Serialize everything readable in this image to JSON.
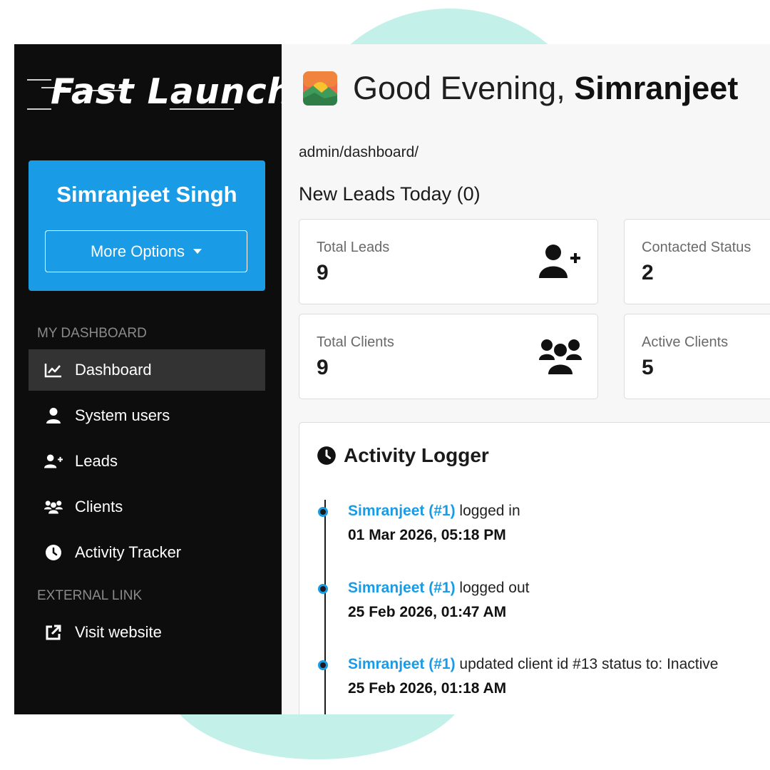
{
  "brand": {
    "logo_text": "Fast Launch"
  },
  "profile": {
    "name": "Simranjeet Singh",
    "more_options_label": "More Options"
  },
  "sidebar": {
    "sections": [
      {
        "label": "MY DASHBOARD"
      },
      {
        "label": "EXTERNAL LINK"
      }
    ],
    "items": [
      {
        "label": "Dashboard",
        "icon": "chart-line-icon",
        "active": true
      },
      {
        "label": "System users",
        "icon": "user-icon",
        "active": false
      },
      {
        "label": "Leads",
        "icon": "user-plus-icon",
        "active": false
      },
      {
        "label": "Clients",
        "icon": "users-icon",
        "active": false
      },
      {
        "label": "Activity Tracker",
        "icon": "clock-icon",
        "active": false
      },
      {
        "label": "Visit website",
        "icon": "external-link-icon",
        "active": false
      }
    ]
  },
  "header": {
    "greeting": "Good Evening, ",
    "user_first_name": "Simranjeet",
    "breadcrumb": "admin/dashboard/",
    "new_leads_heading": "New Leads Today (0)"
  },
  "stats": [
    {
      "label": "Total Leads",
      "value": "9",
      "icon": "user-plus-icon"
    },
    {
      "label": "Contacted Status",
      "value": "2",
      "icon": ""
    },
    {
      "label": "Total Clients",
      "value": "9",
      "icon": "users-icon"
    },
    {
      "label": "Active Clients",
      "value": "5",
      "icon": ""
    }
  ],
  "activity": {
    "title": "Activity Logger",
    "entries": [
      {
        "user": "Simranjeet (#1)",
        "action": " logged in",
        "time": "01 Mar 2026, 05:18 PM"
      },
      {
        "user": "Simranjeet (#1)",
        "action": " logged out",
        "time": "25 Feb 2026, 01:47 AM"
      },
      {
        "user": "Simranjeet (#1)",
        "action": " updated client id #13 status to: Inactive",
        "time": "25 Feb 2026, 01:18 AM"
      }
    ]
  },
  "colors": {
    "accent": "#1a9be6",
    "sidebar_bg": "#0d0d0d",
    "active_item_bg": "#333333",
    "blob": "#c3f1ea"
  }
}
